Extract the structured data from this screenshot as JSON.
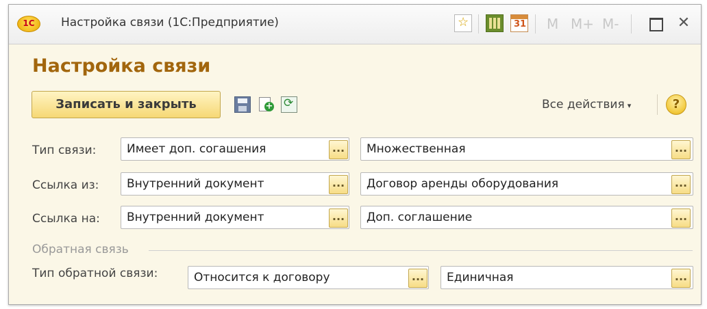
{
  "window": {
    "title": "Настройка связи (1С:Предприятие)",
    "logo_text": "1С",
    "calendar_day": "31",
    "mem_labels": [
      "M",
      "M+",
      "M-"
    ],
    "close_glyph": "✕"
  },
  "form": {
    "header": "Настройка связи",
    "save_close_label": "Записать и закрыть",
    "all_actions_label": "Все действия",
    "all_actions_caret": "▾",
    "help_glyph": "?"
  },
  "rows": [
    {
      "label": "Тип связи:",
      "left_value": "Имеет доп. согашения",
      "right_value": "Множественная"
    },
    {
      "label": "Ссылка из:",
      "left_value": "Внутренний документ",
      "right_value": "Договор аренды оборудования"
    },
    {
      "label": "Ссылка на:",
      "left_value": "Внутренний документ",
      "right_value": "Доп. соглашение"
    }
  ],
  "feedback": {
    "group_title": "Обратная связь",
    "label": "Тип обратной связи:",
    "left_value": "Относится к договору",
    "right_value": "Единичная"
  },
  "choice_button_text": "...",
  "colors": {
    "form_background": "#fbf7e7",
    "header_color": "#a2660d",
    "button_gradient_bottom": "#f6d875"
  }
}
